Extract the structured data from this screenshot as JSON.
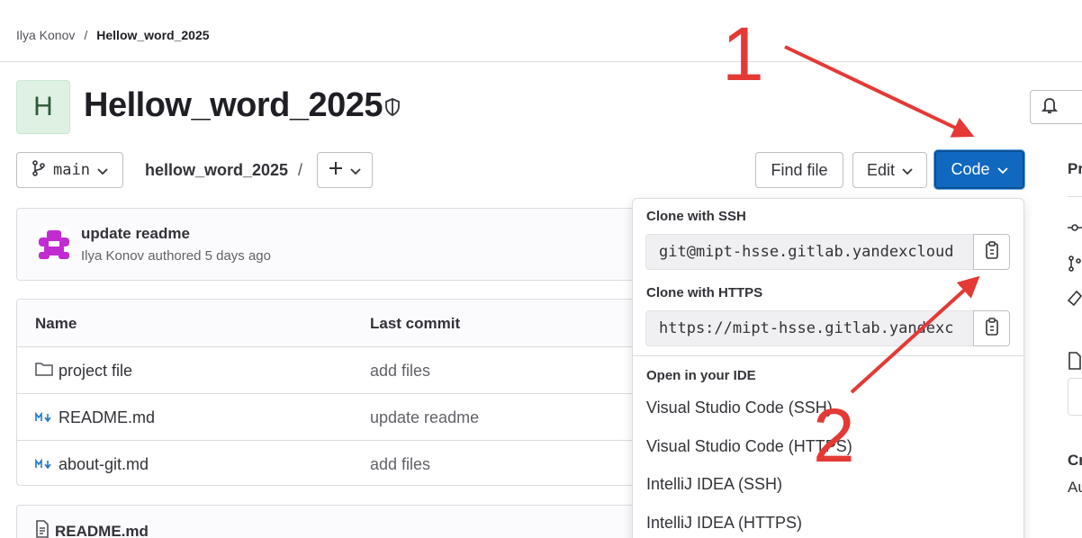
{
  "breadcrumb": {
    "user": "Ilya Konov",
    "separator": "/",
    "project": "Hellow_word_2025"
  },
  "project": {
    "avatar_letter": "H",
    "title": "Hellow_word_2025"
  },
  "toolbar": {
    "branch": "main",
    "path": "hellow_word_2025",
    "path_separator": "/",
    "find_file": "Find file",
    "edit": "Edit",
    "code": "Code"
  },
  "commit": {
    "title": "update readme",
    "author": "Ilya Konov",
    "meta": "authored 5 days ago"
  },
  "files": {
    "headers": {
      "name": "Name",
      "last_commit": "Last commit"
    },
    "rows": [
      {
        "name": "project file",
        "commit": "add files",
        "icon": "folder-icon"
      },
      {
        "name": "README.md",
        "commit": "update readme",
        "icon": "markdown-icon"
      },
      {
        "name": "about-git.md",
        "commit": "add files",
        "icon": "markdown-icon"
      }
    ]
  },
  "readme": {
    "title": "README.md"
  },
  "clone_dropdown": {
    "ssh_label": "Clone with SSH",
    "ssh_url": "git@mipt-hsse.gitlab.yandexcloud",
    "https_label": "Clone with HTTPS",
    "https_url": "https://mipt-hsse.gitlab.yandexc",
    "ide_label": "Open in your IDE",
    "ide_items": [
      "Visual Studio Code (SSH)",
      "Visual Studio Code (HTTPS)",
      "IntelliJ IDEA (SSH)",
      "IntelliJ IDEA (HTTPS)"
    ]
  },
  "right_panel": {
    "pr": "Pr",
    "cr": "Cr",
    "au": "Au"
  },
  "annotations": {
    "first": "1",
    "second": "2",
    "color": "#e53935"
  },
  "colors": {
    "primary": "#1068bf",
    "avatar_bg": "#dff1e3"
  }
}
